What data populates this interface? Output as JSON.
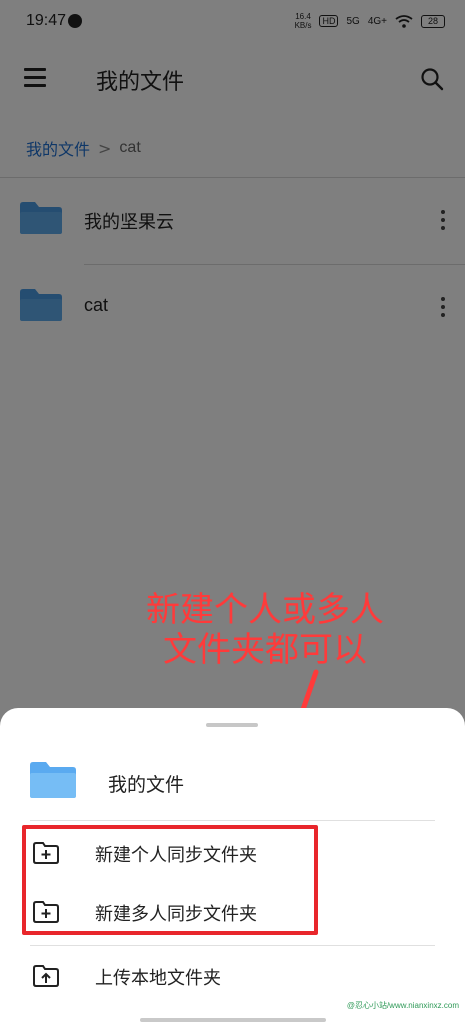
{
  "status": {
    "time": "19:47",
    "net_speed_value": "16.4",
    "net_speed_unit": "KB/s",
    "hd_label": "HD",
    "net1": "5G",
    "net2": "4G+",
    "battery": "28"
  },
  "appbar": {
    "title": "我的文件"
  },
  "breadcrumb": {
    "root": "我的文件",
    "separator": ">",
    "current": "cat"
  },
  "files": [
    {
      "name": "我的坚果云"
    },
    {
      "name": "cat"
    }
  ],
  "annotation": {
    "line1": "新建个人或多人",
    "line2": "文件夹都可以"
  },
  "sheet": {
    "header_label": "我的文件",
    "options": [
      {
        "label": "新建个人同步文件夹"
      },
      {
        "label": "新建多人同步文件夹"
      },
      {
        "label": "上传本地文件夹"
      }
    ]
  },
  "watermark": "@忍心小站/www.nianxinxz.com",
  "colors": {
    "folder": "#4a9be3",
    "folder_light": "#6fb8f2",
    "annotation": "#ff3a3a",
    "breadcrumb_link": "#1e6fd0"
  }
}
